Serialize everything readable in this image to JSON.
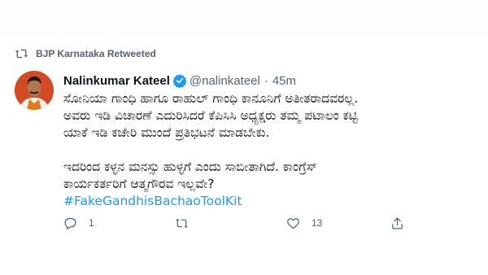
{
  "retweet": {
    "label": "BJP Karnataka Retweeted"
  },
  "tweet": {
    "author_name": "Nalinkumar Kateel",
    "handle": "@nalinkateel",
    "separator": "·",
    "time": "45m",
    "line1": "ಸೋನಿಯಾ ಗಾಂಧಿ ಹಾಗೂ ರಾಹುಲ್ ಗಾಂಧಿ ಕಾನೂನಿಗೆ ಅತೀತರಾದವರಲ್ಲ.",
    "line2": "ಅವರು ಇಡಿ ವಿಚಾರಣೆ ಎದುರಿಸಿದರೆ ಕೆಪಿಸಿಸಿ ಅಧ್ಯಕ್ಷರು ತಮ್ಮ ಪಟಾಲಂ ಕಟ್ಟಿ",
    "line3": "ಯಾಕೆ ಇಡಿ ಕಚೇರಿ ಮುಂದೆ ಪ್ರತಿಭಟನೆ ಮಾಡಬೇಕು.",
    "line4": "ಇದರಿಂದ ಕಳ್ಳನ ಮನಸ್ಸು ಹುಳ್ಳಗೆ ಎಂದು ಸಾಬೀತಾಗಿದೆ. ಕಾಂಗ್ರೆಸ್",
    "line5": "ಕಾರ್ಯಕರ್ತರಿಗೆ ಆತ್ಮಗೌರವ ಇಲ್ಲವೇ?",
    "hashtag": "#FakeGandhisBachaoToolKit"
  },
  "actions": {
    "reply_count": "1",
    "retweet_count": "",
    "like_count": "13"
  },
  "colors": {
    "accent": "#1d9bf0",
    "muted": "#536471",
    "text": "#0f1419"
  },
  "icons": [
    "retweet-icon",
    "verified-badge-icon",
    "reply-icon",
    "like-icon",
    "share-icon"
  ]
}
